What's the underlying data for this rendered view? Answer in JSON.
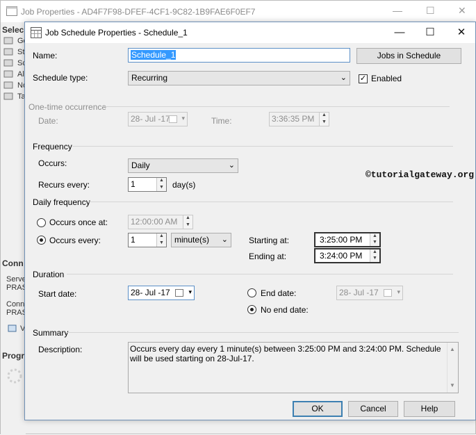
{
  "background_window": {
    "title": "Job Properties - AD4F7F98-DFEF-4CF1-9C82-1B9FAE6F0EF7",
    "select_header": "Selec",
    "nav_items": [
      "Ge",
      "St",
      "Sc",
      "Al",
      "No",
      "Ta"
    ],
    "connection_header": "Conn",
    "server_label": "Serve",
    "server_value": "PRAS",
    "connection_label": "Conn",
    "connection_value": "PRAS",
    "view_link": "V",
    "progress_header": "Progr"
  },
  "dialog": {
    "title": "Job Schedule Properties - Schedule_1",
    "name_label": "Name:",
    "name_value": "Schedule_1",
    "jobs_button": "Jobs in Schedule",
    "schedule_type_label": "Schedule type:",
    "schedule_type_value": "Recurring",
    "enabled_label": "Enabled",
    "one_time_header": "One-time occurrence",
    "one_time_date_label": "Date:",
    "one_time_date_value": "28- Jul -17",
    "one_time_time_label": "Time:",
    "one_time_time_value": "3:36:35 PM",
    "frequency_header": "Frequency",
    "occurs_label": "Occurs:",
    "occurs_value": "Daily",
    "recurs_label": "Recurs every:",
    "recurs_value": "1",
    "recurs_unit": "day(s)",
    "daily_freq_header": "Daily frequency",
    "occurs_once_label": "Occurs once at:",
    "occurs_once_value": "12:00:00 AM",
    "occurs_every_label": "Occurs every:",
    "occurs_every_value": "1",
    "occurs_every_unit": "minute(s)",
    "starting_label": "Starting at:",
    "starting_value": "3:25:00 PM",
    "ending_label": "Ending at:",
    "ending_value": "3:24:00 PM",
    "duration_header": "Duration",
    "start_date_label": "Start date:",
    "start_date_value": "28- Jul -17",
    "end_date_label": "End date:",
    "end_date_value": "28- Jul -17",
    "no_end_date_label": "No end date:",
    "summary_header": "Summary",
    "description_label": "Description:",
    "description_value": "Occurs every day every 1 minute(s) between 3:25:00 PM and 3:24:00 PM. Schedule will be used starting on 28-Jul-17.",
    "ok_button": "OK",
    "cancel_button": "Cancel",
    "help_button": "Help",
    "watermark": "©tutorialgateway.org"
  },
  "state": {
    "enabled_checked": true,
    "occurs_once_selected": false,
    "occurs_every_selected": true,
    "end_date_selected": false,
    "no_end_date_selected": true
  },
  "icons": [
    "window-icon",
    "calendar-icon",
    "minimize-icon",
    "maximize-icon",
    "close-icon",
    "dropdown-arrow-icon",
    "spin-up-icon",
    "spin-down-icon",
    "checkbox-icon",
    "radio-icon",
    "scroll-up-icon",
    "scroll-down-icon"
  ],
  "colors": {
    "dialog_bg": "#f0f0f0",
    "dialog_border": "#6e8fb5",
    "default_button_border": "#3c7fb1",
    "name_selection": "#3399ff",
    "disabled_text": "#8e8e8e"
  }
}
